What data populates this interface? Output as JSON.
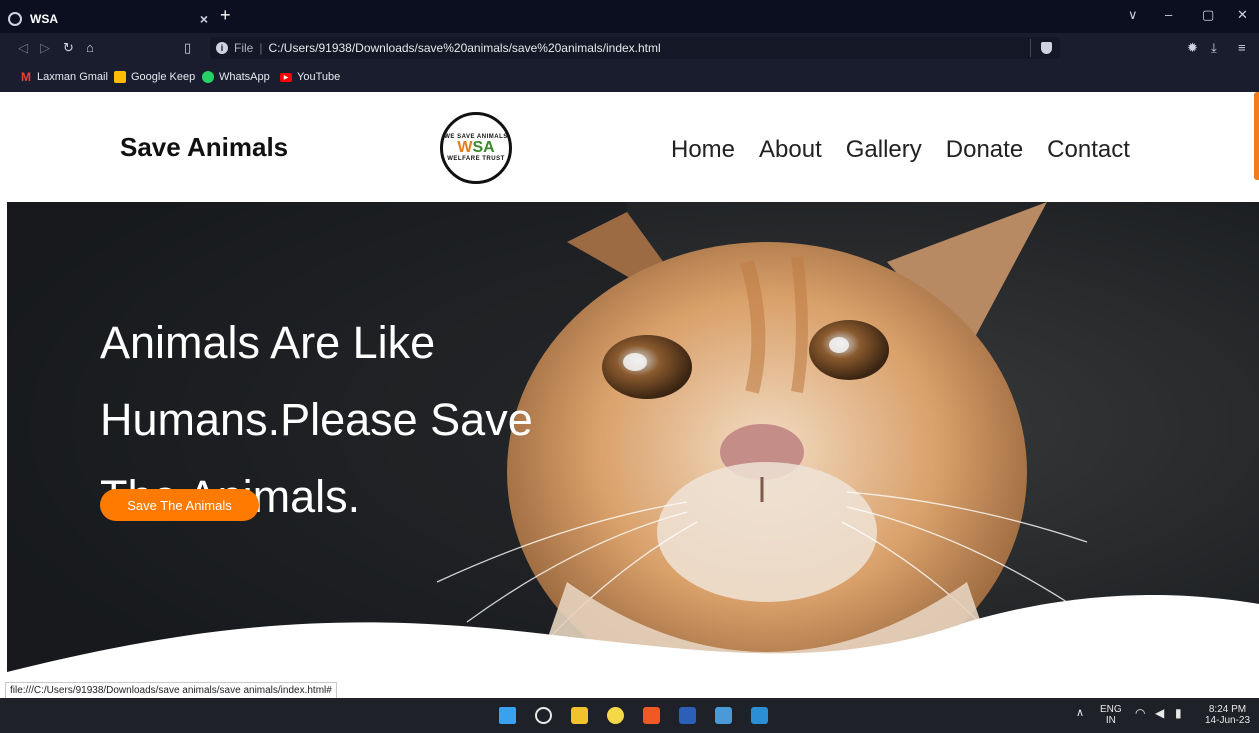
{
  "browser": {
    "tab_title": "WSA",
    "tab_close": "×",
    "new_tab": "+",
    "url_file_label": "File",
    "url_separator": "|",
    "url": "C:/Users/91938/Downloads/save%20animals/save%20animals/index.html",
    "bookmarks": [
      {
        "label": "Laxman Gmail",
        "icon": "gmail-icon",
        "color": "#ea4335"
      },
      {
        "label": "Google Keep",
        "icon": "keep-icon",
        "color": "#fbbc04"
      },
      {
        "label": "WhatsApp",
        "icon": "whatsapp-icon",
        "color": "#25d366"
      },
      {
        "label": "YouTube",
        "icon": "youtube-icon",
        "color": "#ff0000"
      }
    ],
    "status_url": "file:///C:/Users/91938/Downloads/save animals/save animals/index.html#"
  },
  "site": {
    "brand": "Save Animals",
    "logo_top": "WE SAVE ANIMALS",
    "logo_bottom": "WELFARE TRUST",
    "logo_mark_w": "W",
    "logo_mark_sa": "SA",
    "nav": [
      "Home",
      "About",
      "Gallery",
      "Donate",
      "Contact"
    ],
    "hero": {
      "headline": "Animals Are Like Humans.Please Save The Animals.",
      "button": "Save The Animals"
    }
  },
  "taskbar": {
    "lang_top": "ENG",
    "lang_bottom": "IN",
    "time": "8:24 PM",
    "date": "14-Jun-23"
  },
  "colors": {
    "accent": "#ff7a00",
    "chrome_dark": "#0c0f1f",
    "chrome": "#1a1d2e"
  }
}
